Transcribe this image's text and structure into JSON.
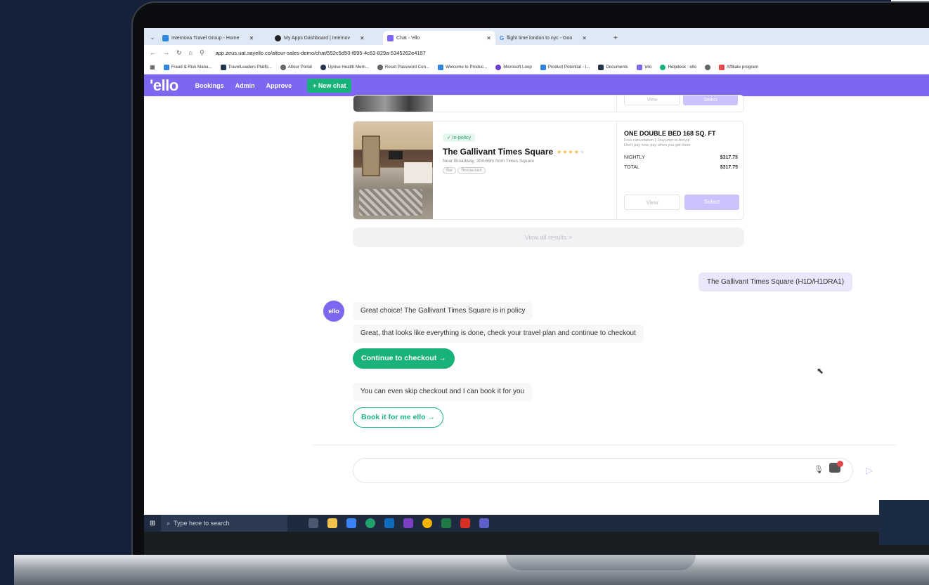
{
  "browser": {
    "tabs": [
      {
        "label": "Internova Travel Group - Home",
        "color": "#2e86de"
      },
      {
        "label": "My Apps Dashboard | Internov",
        "color": "#222222"
      },
      {
        "label": "Chat - 'ello",
        "color": "#7d67f0"
      },
      {
        "label": "flight time london to nyc - Goo",
        "color": "#4285f4"
      }
    ],
    "url": "app.zeus.uat.sayello.co/altour-sales-demo/chat/552c5d50-f895-4c63-829a-5345262e4157",
    "bookmarks": [
      {
        "label": "Fraud & Risk Mana...",
        "color": "#2e86de"
      },
      {
        "label": "TravelLeaders Platfo...",
        "color": "#24344d"
      },
      {
        "label": "Altour Portal",
        "color": "#666666"
      },
      {
        "label": "Uprise Health Mem...",
        "color": "#24344d"
      },
      {
        "label": "Reset Password Con...",
        "color": "#666666"
      },
      {
        "label": "Welcome to Produc...",
        "color": "#2e86de"
      },
      {
        "label": "Microsoft Loop",
        "color": "#6b3fd1"
      },
      {
        "label": "Product Potential - I...",
        "color": "#2e86de"
      },
      {
        "label": "Documents",
        "color": "#24344d"
      },
      {
        "label": "'ello",
        "color": "#7d67f0"
      },
      {
        "label": "Helpdesk : ello",
        "color": "#19b37a"
      },
      {
        "label": "Affiliate program",
        "color": "#e5484d"
      }
    ]
  },
  "app": {
    "logo": "'ello",
    "nav": [
      "Bookings",
      "Admin",
      "Approve"
    ],
    "new_chat": "+ New chat"
  },
  "prev_card": {
    "view": "View",
    "select": "Select"
  },
  "hotel": {
    "policy": "✓ In-policy",
    "name": "The Gallivant Times Square",
    "location": "Near Broadway, 304.69m from Times Square",
    "amenities": [
      "Bar",
      "Restaurant"
    ],
    "room": "ONE DOUBLE BED 168 SQ. FT",
    "note1": "Free cancellation 1 Day prior to Arrival",
    "note2": "Don't pay now, pay when you get there",
    "nightly_label": "NIGHTLY",
    "nightly": "$317.75",
    "total_label": "TOTAL",
    "total": "$317.75",
    "view": "View",
    "select": "Select"
  },
  "view_all": "View all results  >",
  "user_message": "The Gallivant Times Square (H1D/H1DRA1)",
  "bot": {
    "avatar": "ello",
    "msg1": "Great choice! The Gallivant Times Square is in policy",
    "msg2": "Great, that looks like everything is done, check your travel plan and continue to checkout",
    "checkout": "Continue to checkout  →",
    "msg3": "You can even skip checkout and I can book it for you",
    "bookit": "Book it for me ello  →"
  },
  "taskbar": {
    "search_placeholder": "Type here to search"
  },
  "colors": {
    "brand": "#7d67f0",
    "accent": "#19b37a"
  }
}
